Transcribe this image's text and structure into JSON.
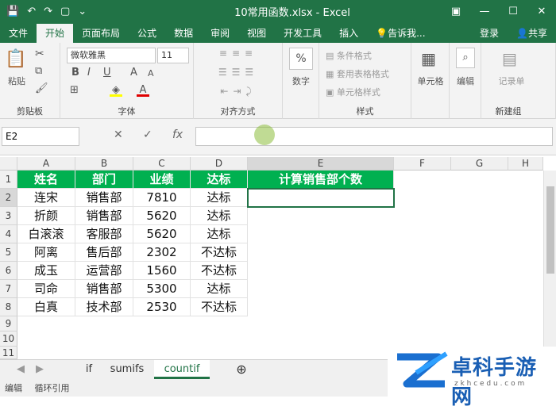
{
  "window": {
    "title": "10常用函数.xlsx - Excel",
    "qat": {
      "save_icon": "save-icon",
      "undo_icon": "undo-icon",
      "redo_icon": "redo-icon",
      "touch_icon": "touch-mode-icon"
    },
    "controls": [
      "▣",
      "—",
      "☐",
      "✕"
    ]
  },
  "ribbon_tabs": [
    "文件",
    "开始",
    "页面布局",
    "公式",
    "数据",
    "审阅",
    "视图",
    "开发工具",
    "插入"
  ],
  "tell_me": "告诉我...",
  "login": "登录",
  "share": "共享",
  "ribbon": {
    "clipboard": {
      "label": "剪贴板",
      "paste": "粘贴"
    },
    "font": {
      "label": "字体",
      "name": "微软雅黑",
      "size": "11",
      "bold": "B",
      "italic": "I",
      "underline": "U"
    },
    "alignment": {
      "label": "对齐方式"
    },
    "number": {
      "label": "数字",
      "button": "数字"
    },
    "styles": {
      "label": "样式",
      "conditional": "条件格式",
      "table_format": "套用表格格式",
      "cell_style": "单元格样式"
    },
    "cells": {
      "button": "单元格"
    },
    "editing": {
      "button": "编辑"
    },
    "new_group": {
      "label": "新建组",
      "button": "记录单"
    }
  },
  "formula_bar": {
    "name_box": "E2",
    "cancel": "✕",
    "enter": "✓",
    "fx": "fx",
    "value": ""
  },
  "columns": [
    "A",
    "B",
    "C",
    "D",
    "E",
    "F",
    "G",
    "H"
  ],
  "rows": [
    "1",
    "2",
    "3",
    "4",
    "5",
    "6",
    "7",
    "8",
    "9",
    "10",
    "11"
  ],
  "table": {
    "headers": [
      "姓名",
      "部门",
      "业绩",
      "达标",
      "计算销售部个数"
    ],
    "data": [
      [
        "连宋",
        "销售部",
        "7810",
        "达标"
      ],
      [
        "折颜",
        "销售部",
        "5620",
        "达标"
      ],
      [
        "白滚滚",
        "客服部",
        "5620",
        "达标"
      ],
      [
        "阿离",
        "售后部",
        "2302",
        "不达标"
      ],
      [
        "成玉",
        "运营部",
        "1560",
        "不达标"
      ],
      [
        "司命",
        "销售部",
        "5300",
        "达标"
      ],
      [
        "白真",
        "技术部",
        "2530",
        "不达标"
      ]
    ]
  },
  "sheets": [
    "if",
    "sumifs",
    "countif"
  ],
  "active_sheet": "countif",
  "status": {
    "left": "编辑",
    "mode": "循环引用"
  },
  "watermark": {
    "text": "卓科手游网",
    "url": "z k h c e d u . c o m"
  },
  "colors": {
    "excel_green": "#217346",
    "header_fill": "#00b050"
  }
}
